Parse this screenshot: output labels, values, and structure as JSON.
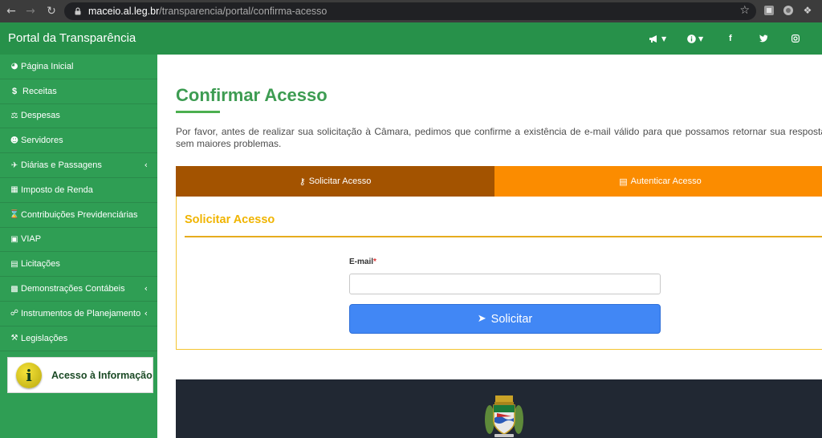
{
  "browser": {
    "url_host": "maceio.al.leg.br",
    "url_path": "/transparencia/portal/confirma-acesso",
    "icons": [
      "back-icon",
      "forward-icon",
      "reload-icon",
      "lock-icon",
      "star-icon",
      "extension-icon",
      "puzzle-icon",
      "profile-icon"
    ]
  },
  "navbar": {
    "brand": "Portal da Transparência",
    "icons": [
      "megaphone-icon",
      "info-icon",
      "facebook-icon",
      "twitter-icon",
      "instagram-icon"
    ],
    "color": "#27914a"
  },
  "sidebar": {
    "color": "#2f9e54",
    "items": [
      {
        "label": "Página Inicial",
        "icon": "tachometer-icon",
        "has_sub": false
      },
      {
        "label": "Receitas",
        "icon": "dollar-icon",
        "has_sub": false
      },
      {
        "label": "Despesas",
        "icon": "balance-icon",
        "has_sub": false
      },
      {
        "label": "Servidores",
        "icon": "users-icon",
        "has_sub": false
      },
      {
        "label": "Diárias e Passagens",
        "icon": "plane-icon",
        "has_sub": true
      },
      {
        "label": "Imposto de Renda",
        "icon": "calculator-icon",
        "has_sub": false
      },
      {
        "label": "Contribuições Previdenciárias",
        "icon": "hourglass-icon",
        "has_sub": false
      },
      {
        "label": "VIAP",
        "icon": "money-icon",
        "has_sub": false
      },
      {
        "label": "Licitações",
        "icon": "briefcase-icon",
        "has_sub": false
      },
      {
        "label": "Demonstrações Contábeis",
        "icon": "bar-chart-icon",
        "has_sub": true
      },
      {
        "label": "Instrumentos de Planejamento",
        "icon": "handshake-icon",
        "has_sub": true
      },
      {
        "label": "Legislações",
        "icon": "gavel-icon",
        "has_sub": false
      }
    ],
    "banner_label": "Acesso à Informação"
  },
  "main": {
    "title": "Confirmar Acesso",
    "intro": "Por favor, antes de realizar sua solicitação à Câmara, pedimos que confirme a existência de e-mail válido para que possamos retornar sua resposta sem maiores problemas.",
    "tabs": [
      {
        "label": "Solicitar Acesso",
        "icon": "key-icon",
        "active": true
      },
      {
        "label": "Autenticar Acesso",
        "icon": "id-card-icon",
        "active": false
      }
    ],
    "panel": {
      "title": "Solicitar Acesso",
      "email_label": "E-mail",
      "required_mark": "*",
      "email_value": "",
      "submit_label": "Solicitar",
      "submit_icon": "paper-plane-icon"
    }
  },
  "colors": {
    "title": "#3d9c52",
    "tab_active": "#a35300",
    "tab_inactive": "#fb8c00",
    "panel_title": "#f0b400",
    "submit": "#4187f5",
    "footer": "#212833"
  }
}
